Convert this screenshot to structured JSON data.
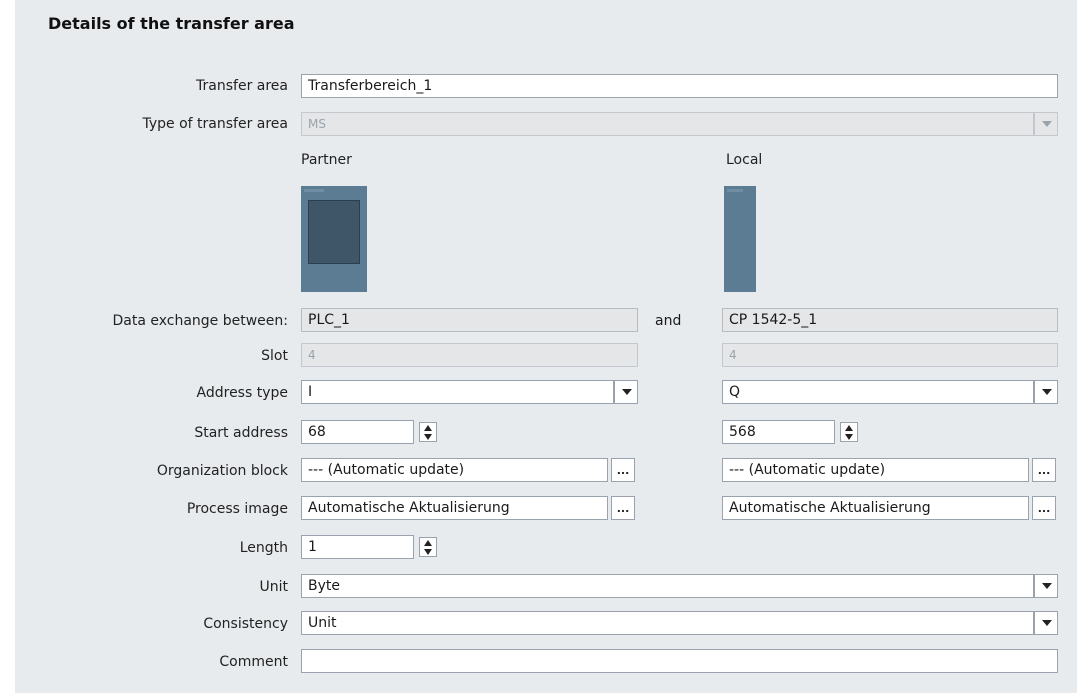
{
  "section_title": "Details of the transfer area",
  "labels": {
    "transfer_area": "Transfer area",
    "type_of_transfer_area": "Type of transfer area",
    "data_exchange_between": "Data exchange between:",
    "and": "and",
    "slot": "Slot",
    "address_type": "Address type",
    "start_address": "Start address",
    "organization_block": "Organization block",
    "process_image": "Process image",
    "length": "Length",
    "unit": "Unit",
    "consistency": "Consistency",
    "comment": "Comment"
  },
  "transfer_area_value": "Transferbereich_1",
  "type_of_transfer_area_value": "MS",
  "partner": {
    "heading": "Partner",
    "device_name": "PLC_1",
    "slot": "4",
    "address_type": "I",
    "start_address": "68",
    "organization_block": "--- (Automatic update)",
    "process_image": "Automatische Aktualisierung",
    "ellipsis": "..."
  },
  "local": {
    "heading": "Local",
    "device_name": "CP 1542-5_1",
    "slot": "4",
    "address_type": "Q",
    "start_address": "568",
    "organization_block": "--- (Automatic update)",
    "process_image": "Automatische Aktualisierung",
    "ellipsis": "..."
  },
  "length_value": "1",
  "unit_value": "Byte",
  "consistency_value": "Unit",
  "comment_value": "",
  "colors": {
    "panel_bg": "#e8ebee",
    "device_body": "#5c7c93",
    "device_screen": "#3e5668"
  }
}
